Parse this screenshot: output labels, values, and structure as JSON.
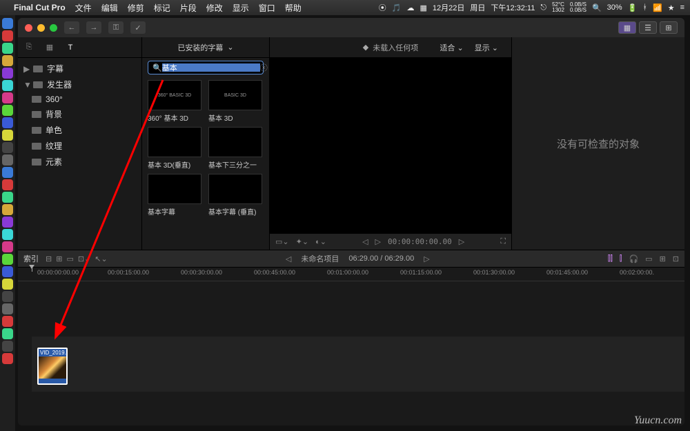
{
  "menubar": {
    "app_name": "Final Cut Pro",
    "items": [
      "文件",
      "编辑",
      "修剪",
      "标记",
      "片段",
      "修改",
      "显示",
      "窗口",
      "帮助"
    ],
    "status": {
      "date": "12月22日",
      "day": "周日",
      "time": "下午12:32:11",
      "temp": "52°C",
      "temp2": "1302",
      "cpu": "0.0B/S",
      "net": "0.0B/S",
      "battery": "30%"
    }
  },
  "titlebar": {
    "back": "←",
    "fwd": "→",
    "key": "⚿",
    "check": "✓"
  },
  "sidebar": {
    "items": [
      {
        "label": "字幕",
        "parent": true,
        "expanded": true
      },
      {
        "label": "发生器",
        "parent": true,
        "expanded": true
      },
      {
        "label": "360°"
      },
      {
        "label": "背景"
      },
      {
        "label": "单色"
      },
      {
        "label": "纹理"
      },
      {
        "label": "元素"
      }
    ]
  },
  "browser": {
    "dropdown": "已安装的字幕",
    "search_value": "基本",
    "items": [
      {
        "label": "360° 基本 3D",
        "thumb_text": "360° BASIC 3D"
      },
      {
        "label": "基本 3D",
        "thumb_text": "BASIC 3D"
      },
      {
        "label": "基本 3D(垂直)",
        "thumb_text": ""
      },
      {
        "label": "基本下三分之一",
        "thumb_text": ""
      },
      {
        "label": "基本字幕",
        "thumb_text": ""
      },
      {
        "label": "基本字幕 (垂直)",
        "thumb_text": ""
      }
    ]
  },
  "viewer": {
    "empty_text": "未载入任何项",
    "fit": "适合",
    "display": "显示",
    "timecode": "00:00:00:00.00"
  },
  "inspector": {
    "empty": "没有可检查的对象"
  },
  "timeline_bar": {
    "index": "索引",
    "project": "未命名项目",
    "time": "06:29.00 / 06:29.00"
  },
  "ruler": {
    "marks": [
      "00:00:00:00.00",
      "00:00:15:00.00",
      "00:00:30:00.00",
      "00:00:45:00.00",
      "00:01:00:00.00",
      "00:01:15:00.00",
      "00:01:30:00.00",
      "00:01:45:00.00",
      "00:02:00:00."
    ]
  },
  "clip": {
    "name": "VID_2019..."
  },
  "watermark": "Yuucn.com"
}
